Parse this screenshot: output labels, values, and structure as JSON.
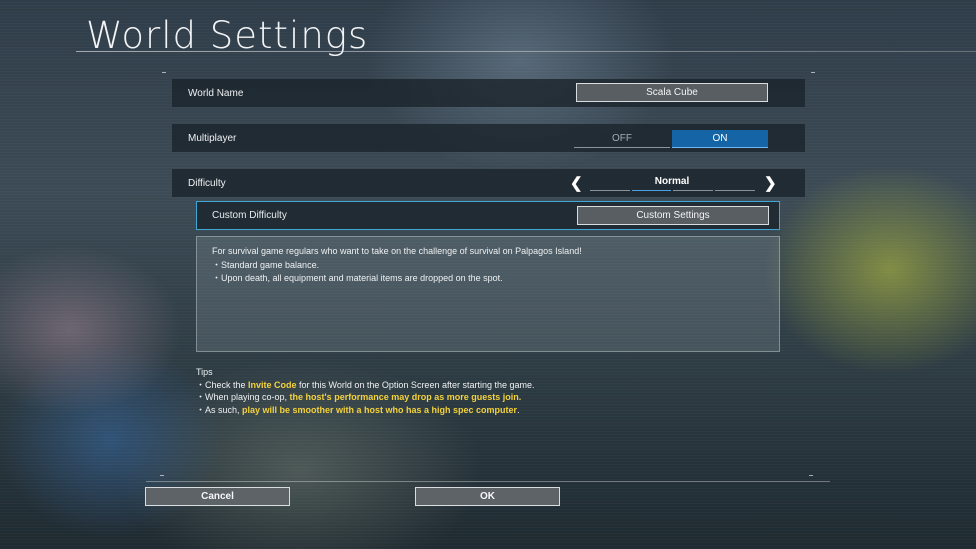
{
  "screen": {
    "title": "World Settings"
  },
  "world_name": {
    "label": "World Name",
    "value": "Scala Cube"
  },
  "multiplayer": {
    "label": "Multiplayer",
    "off_label": "OFF",
    "on_label": "ON",
    "selected": "ON"
  },
  "difficulty": {
    "label": "Difficulty",
    "value": "Normal"
  },
  "custom_difficulty": {
    "label": "Custom Difficulty",
    "button_label": "Custom Settings"
  },
  "description": {
    "intro": "For survival game regulars who want to take on the challenge of survival on Palpagos Island!",
    "bullet1": "・Standard game balance.",
    "bullet2": "・Upon death, all equipment and material items are dropped on the spot."
  },
  "tips": {
    "heading": "Tips",
    "line1_pre": "・Check the ",
    "line1_hl": "Invite Code",
    "line1_post": " for this World on the Option Screen after starting the game.",
    "line2_pre": "・When playing co-op, ",
    "line2_hl": "the host's performance may drop as more guests join.",
    "line3_pre": "・As such, ",
    "line3_hl": "play will be smoother with a host who has a high spec computer",
    "line3_post": "."
  },
  "actions": {
    "cancel_label": "Cancel",
    "ok_label": "OK"
  },
  "colors": {
    "accent_blue": "#1565a6",
    "highlight_yellow": "#f4d23c",
    "focus_border": "#3fa6d8"
  }
}
